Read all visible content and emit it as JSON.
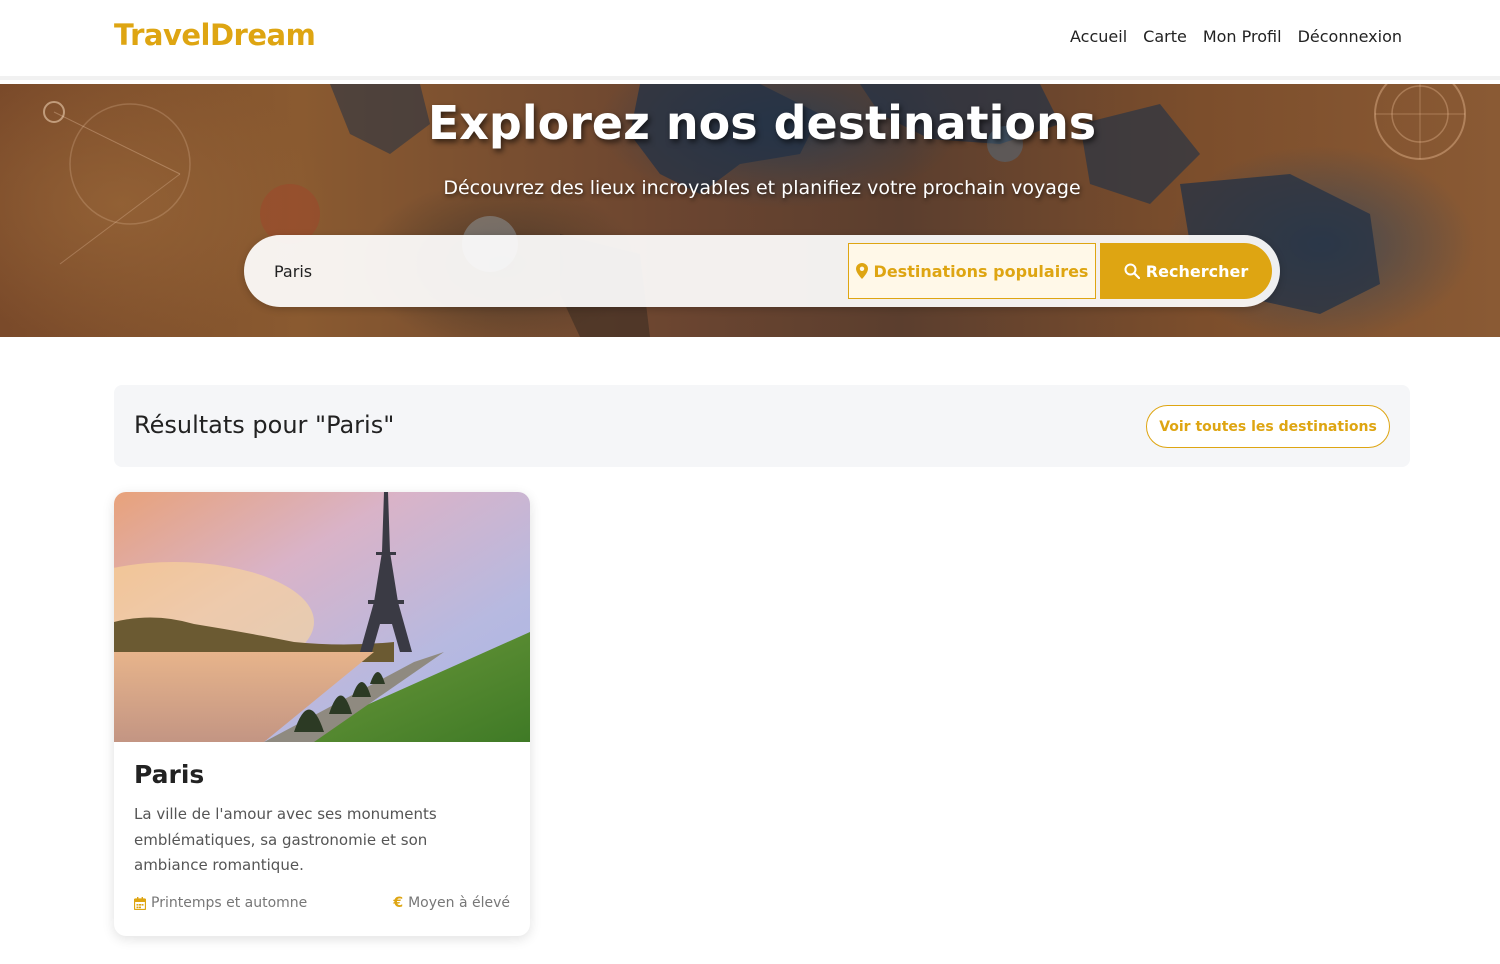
{
  "navbar": {
    "brand": "TravelDream",
    "links": [
      "Accueil",
      "Carte",
      "Mon Profil",
      "Déconnexion"
    ]
  },
  "hero": {
    "title": "Explorez nos destinations",
    "subtitle": "Découvrez des lieux incroyables et planifiez votre prochain voyage",
    "search": {
      "value": "Paris",
      "popular_label": "Destinations populaires",
      "popular_icon": "map-marker-icon",
      "search_label": "Rechercher",
      "search_icon": "magnifier-icon"
    }
  },
  "results": {
    "title": "Résultats pour \"Paris\"",
    "view_all_label": "Voir toutes les destinations"
  },
  "cards": [
    {
      "title": "Paris",
      "description": "La ville de l'amour avec ses monuments emblématiques, sa gastronomie et son ambiance romantique.",
      "season": "Printemps et automne",
      "season_icon": "calendar-icon",
      "budget": "Moyen à élevé",
      "budget_icon": "euro-icon"
    }
  ],
  "colors": {
    "accent": "#dea512",
    "text": "#222222",
    "muted": "#777777",
    "panel": "#f5f6f8"
  }
}
